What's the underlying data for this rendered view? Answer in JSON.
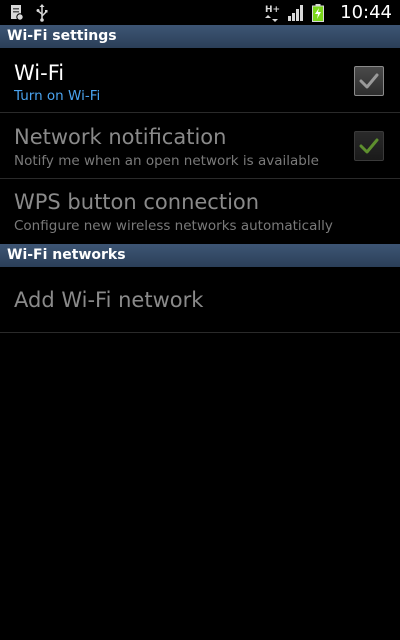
{
  "status_bar": {
    "left_icons": [
      "notification-icon",
      "usb-icon"
    ],
    "right_icons": [
      "hspa-icon",
      "signal-icon",
      "battery-charging-icon"
    ],
    "network_type": "H+",
    "time": "10:44"
  },
  "sections": {
    "wifi_settings": "Wi-Fi settings",
    "wifi_networks": "Wi-Fi networks"
  },
  "items": {
    "wifi": {
      "title": "Wi-Fi",
      "summary": "Turn on Wi-Fi",
      "checked": false
    },
    "network_notification": {
      "title": "Network notification",
      "summary": "Notify me when an open network is available",
      "checked": true
    },
    "wps": {
      "title": "WPS button connection",
      "summary": "Configure new wireless networks automatically"
    },
    "add_network": {
      "title": "Add Wi-Fi network"
    }
  },
  "colors": {
    "header_bg": "#34506f",
    "summary_blue": "#4aa3ef",
    "battery_green": "#7ad61a",
    "check_green": "#6fa83a"
  }
}
